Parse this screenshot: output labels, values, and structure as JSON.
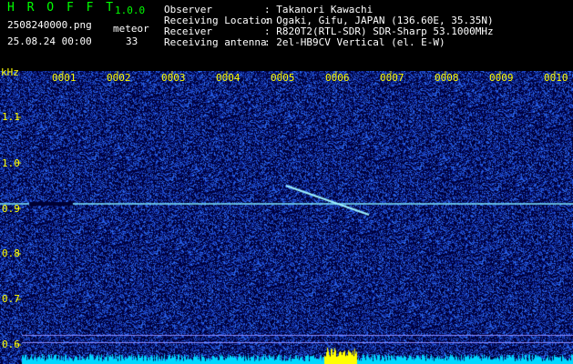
{
  "header": {
    "app_name": "H R O F F T",
    "version": "1.0.0",
    "filename": "2508240000.png",
    "datetime": "25.08.24 00:00",
    "meteor_label": "meteor",
    "meteor_count": "33",
    "info": [
      {
        "label": "Observer",
        "value": ": Takanori Kawachi"
      },
      {
        "label": "Receiving Location",
        "value": ": Ogaki, Gifu, JAPAN (136.60E, 35.35N)"
      },
      {
        "label": "Receiver",
        "value": ": R820T2(RTL-SDR) SDR-Sharp 53.1000MHz"
      },
      {
        "label": "Receiving antenna",
        "value": ": 2el-HB9CV Vertical (el. E-W)"
      }
    ]
  },
  "spectrogram": {
    "y_unit": "kHz",
    "y_ticks": [
      "1.1",
      "1.0",
      "0.9",
      "0.8",
      "0.7",
      "0.6"
    ],
    "x_ticks": [
      "0001",
      "0002",
      "0003",
      "0004",
      "0005",
      "0006",
      "0007",
      "0008",
      "0009",
      "0010"
    ],
    "carrier_khz": 0.91,
    "colors": {
      "background": "#00003a",
      "noise": "#1a3cff",
      "signal": "#7fe8ff",
      "grid": "#8a8aff",
      "text_yellow": "#ffff00",
      "text_green": "#00ff00",
      "text_white": "#ffffff",
      "bar_cyan": "#00d8ff"
    }
  }
}
